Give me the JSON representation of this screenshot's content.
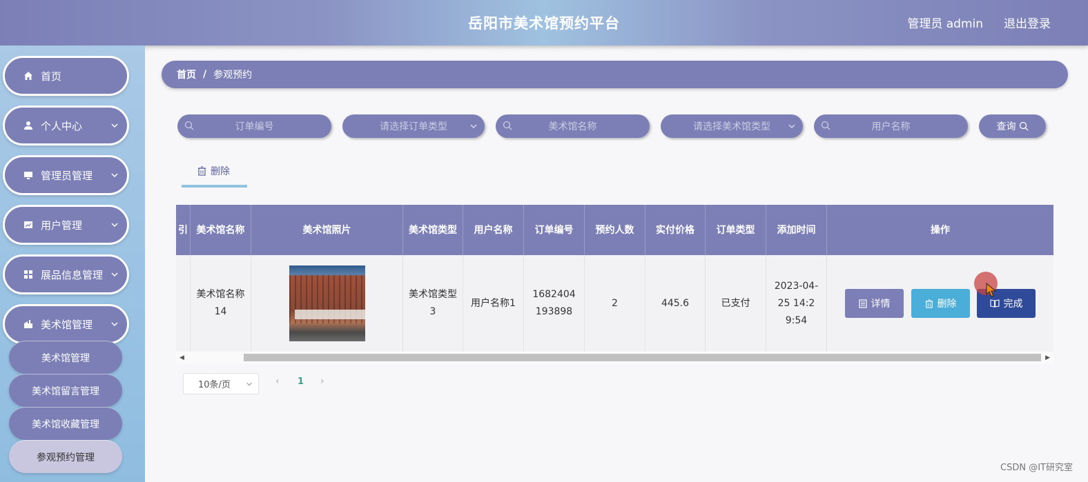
{
  "header": {
    "title": "岳阳市美术馆预约平台",
    "admin": "管理员 admin",
    "logout": "退出登录"
  },
  "sidebar": {
    "items": [
      {
        "label": "首页",
        "icon": "home-icon"
      },
      {
        "label": "个人中心",
        "icon": "user-icon"
      },
      {
        "label": "管理员管理",
        "icon": "monitor-icon"
      },
      {
        "label": "用户管理",
        "icon": "chart-icon"
      },
      {
        "label": "展品信息管理",
        "icon": "grid-icon"
      },
      {
        "label": "美术馆管理",
        "icon": "building-icon"
      }
    ],
    "sub_items": [
      {
        "label": "美术馆管理"
      },
      {
        "label": "美术馆留言管理"
      },
      {
        "label": "美术馆收藏管理"
      },
      {
        "label": "参观预约管理",
        "active": true
      }
    ]
  },
  "breadcrumb": {
    "home": "首页",
    "separator": "/",
    "current": "参观预约"
  },
  "search": {
    "order_no": "订单编号",
    "order_type": "请选择订单类型",
    "museum_name": "美术馆名称",
    "museum_type": "请选择美术馆类型",
    "user_name": "用户名称",
    "query_button": "查询"
  },
  "toolbar": {
    "delete_label": "删除"
  },
  "table": {
    "partial_col": "引",
    "headers": [
      "美术馆名称",
      "美术馆照片",
      "美术馆类型",
      "用户名称",
      "订单编号",
      "预约人数",
      "实付价格",
      "订单类型",
      "添加时间",
      "操作"
    ],
    "rows": [
      {
        "museum_name": "美术馆名称14",
        "museum_type": "美术馆类型3",
        "user_name": "用户名称1",
        "order_no": "1682404193898",
        "people": "2",
        "price": "445.6",
        "order_type": "已支付",
        "add_time": "2023-04-25 14:29:54",
        "actions": {
          "detail": "详情",
          "delete": "删除",
          "complete": "完成"
        }
      }
    ]
  },
  "pagination": {
    "page_size": "10条/页",
    "prev": "‹",
    "current": "1",
    "next": "›"
  },
  "watermark": "CSDN @IT研究室",
  "colors": {
    "primary": "#7b7fb6",
    "delete": "#4aaed8",
    "complete": "#2f4a99",
    "accent": "#8fc3df"
  }
}
